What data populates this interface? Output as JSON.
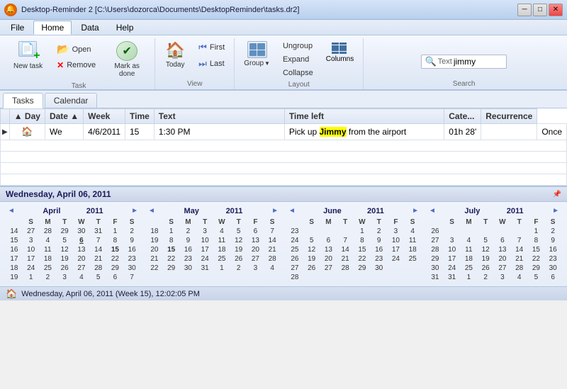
{
  "titleBar": {
    "icon": "🔔",
    "title": "Desktop-Reminder 2 [C:\\Users\\dozorca\\Documents\\DesktopReminder\\tasks.dr2]",
    "controls": {
      "minimize": "─",
      "restore": "□",
      "close": "✕"
    }
  },
  "menuBar": {
    "items": [
      "File",
      "Home",
      "Data",
      "Help"
    ],
    "activeItem": "Home"
  },
  "ribbon": {
    "groups": [
      {
        "label": "Task",
        "items": [
          {
            "id": "new-task",
            "icon": "📋",
            "label": "New task",
            "type": "large"
          },
          {
            "id": "open",
            "icon": "📂",
            "label": "Open",
            "type": "small"
          },
          {
            "id": "remove",
            "icon": "✕",
            "label": "Remove",
            "type": "small",
            "color": "red"
          },
          {
            "id": "mark-done",
            "icon": "✔",
            "label": "Mark as done",
            "type": "large-combo"
          }
        ]
      },
      {
        "label": "View",
        "items": [
          {
            "id": "today",
            "icon": "🏠",
            "label": "Today",
            "type": "large"
          },
          {
            "id": "first",
            "label": "First",
            "type": "small-nav"
          },
          {
            "id": "last",
            "label": "Last",
            "type": "small-nav"
          }
        ]
      },
      {
        "label": "Layout",
        "items": [
          {
            "id": "group",
            "icon": "▦",
            "label": "Group",
            "type": "large-arrow"
          },
          {
            "id": "ungroup",
            "label": "Ungroup",
            "type": "small"
          },
          {
            "id": "expand",
            "label": "Expand",
            "type": "small"
          },
          {
            "id": "collapse",
            "label": "Collapse",
            "type": "small"
          },
          {
            "id": "columns",
            "label": "Columns",
            "type": "columns"
          }
        ]
      },
      {
        "label": "Search",
        "items": [
          {
            "id": "search-text",
            "label": "Text",
            "placeholder": ""
          },
          {
            "id": "search-value",
            "value": "jimmy"
          }
        ]
      }
    ]
  },
  "tabs": [
    "Tasks",
    "Calendar"
  ],
  "activeTab": "Tasks",
  "taskTable": {
    "columns": [
      "",
      "Day",
      "Date",
      "Week",
      "Time",
      "Text",
      "Time left",
      "Cate...",
      "Recurrence"
    ],
    "sortCol": "Day",
    "sortDir": "asc",
    "dateSortDir": "asc",
    "rows": [
      {
        "arrow": "▶",
        "homeIcon": "🏠",
        "day": "We",
        "date": "4/6/2011",
        "week": "15",
        "time": "1:30 PM",
        "textPre": "Pick up ",
        "textHighlight": "Jimmy",
        "textPost": " from the airport",
        "timeLeft": "01h 28'",
        "category": "",
        "recurrence": "Once"
      }
    ]
  },
  "calendarSection": {
    "title": "Wednesday, April 06, 2011",
    "calendars": [
      {
        "month": "April",
        "year": "2011",
        "weekdays": [
          "S",
          "M",
          "T",
          "W",
          "T",
          "F",
          "S"
        ],
        "weeks": [
          {
            "weekNum": "14",
            "days": [
              {
                "day": "27",
                "other": true
              },
              {
                "day": "28",
                "other": true
              },
              {
                "day": "29",
                "other": true
              },
              {
                "day": "30",
                "other": true
              },
              {
                "day": "31",
                "other": true
              },
              {
                "day": "1",
                "sat": false,
                "fri": true
              },
              {
                "day": "2",
                "sat": true
              }
            ]
          },
          {
            "weekNum": "15",
            "days": [
              {
                "day": "3",
                "sun": true
              },
              {
                "day": "4"
              },
              {
                "day": "5"
              },
              {
                "day": "6",
                "today": true
              },
              {
                "day": "7"
              },
              {
                "day": "8"
              },
              {
                "day": "9",
                "sat": true
              }
            ]
          },
          {
            "weekNum": "16",
            "days": [
              {
                "day": "10",
                "sun": true
              },
              {
                "day": "11"
              },
              {
                "day": "12"
              },
              {
                "day": "13"
              },
              {
                "day": "14"
              },
              {
                "day": "15",
                "highlighted": true
              },
              {
                "day": "16",
                "sat": true
              }
            ]
          },
          {
            "weekNum": "17",
            "days": [
              {
                "day": "17",
                "sun": true
              },
              {
                "day": "18"
              },
              {
                "day": "19"
              },
              {
                "day": "20"
              },
              {
                "day": "21"
              },
              {
                "day": "22"
              },
              {
                "day": "23",
                "sat": true
              }
            ]
          },
          {
            "weekNum": "18",
            "days": [
              {
                "day": "24",
                "sun": true
              },
              {
                "day": "25"
              },
              {
                "day": "26"
              },
              {
                "day": "27"
              },
              {
                "day": "28"
              },
              {
                "day": "29"
              },
              {
                "day": "30",
                "sat": true
              }
            ]
          },
          {
            "weekNum": "19",
            "days": [
              {
                "day": "1",
                "sun": true,
                "other": true
              },
              {
                "day": "2",
                "other": true
              },
              {
                "day": "3",
                "other": true
              },
              {
                "day": "4",
                "other": true
              },
              {
                "day": "5",
                "other": true
              },
              {
                "day": "6",
                "other": true
              },
              {
                "day": "7",
                "other": true,
                "sat": true
              }
            ]
          }
        ]
      },
      {
        "month": "May",
        "year": "2011",
        "weekdays": [
          "S",
          "M",
          "T",
          "W",
          "T",
          "F",
          "S"
        ],
        "weeks": [
          {
            "weekNum": "18",
            "days": [
              {
                "day": "1",
                "sun": true
              },
              {
                "day": "2"
              },
              {
                "day": "3"
              },
              {
                "day": "4"
              },
              {
                "day": "5"
              },
              {
                "day": "6"
              },
              {
                "day": "7",
                "sat": true
              }
            ]
          },
          {
            "weekNum": "19",
            "days": [
              {
                "day": "8",
                "sun": true
              },
              {
                "day": "9"
              },
              {
                "day": "10"
              },
              {
                "day": "11"
              },
              {
                "day": "12"
              },
              {
                "day": "13"
              },
              {
                "day": "14",
                "sat": true
              }
            ]
          },
          {
            "weekNum": "20",
            "days": [
              {
                "day": "15",
                "sun": true,
                "highlighted": true
              },
              {
                "day": "16"
              },
              {
                "day": "17"
              },
              {
                "day": "18"
              },
              {
                "day": "19"
              },
              {
                "day": "20"
              },
              {
                "day": "21",
                "sat": true
              }
            ]
          },
          {
            "weekNum": "21",
            "days": [
              {
                "day": "22",
                "sun": true
              },
              {
                "day": "23"
              },
              {
                "day": "24"
              },
              {
                "day": "25"
              },
              {
                "day": "26"
              },
              {
                "day": "27"
              },
              {
                "day": "28",
                "sat": true
              }
            ]
          },
          {
            "weekNum": "22",
            "days": [
              {
                "day": "29",
                "sun": true
              },
              {
                "day": "30"
              },
              {
                "day": "31"
              },
              {
                "day": "1",
                "other": true
              },
              {
                "day": "2",
                "other": true
              },
              {
                "day": "3",
                "other": true
              },
              {
                "day": "4",
                "other": true,
                "sat": true
              }
            ]
          }
        ]
      },
      {
        "month": "June",
        "year": "2011",
        "weekdays": [
          "S",
          "M",
          "T",
          "W",
          "T",
          "F",
          "S"
        ],
        "weeks": [
          {
            "weekNum": "23",
            "days": [
              {
                "day": ""
              },
              {
                "day": ""
              },
              {
                "day": ""
              },
              {
                "day": "1"
              },
              {
                "day": "2"
              },
              {
                "day": "3"
              },
              {
                "day": "4",
                "sat": true
              }
            ]
          },
          {
            "weekNum": "24",
            "days": [
              {
                "day": "5",
                "sun": true
              },
              {
                "day": "6"
              },
              {
                "day": "7"
              },
              {
                "day": "8"
              },
              {
                "day": "9"
              },
              {
                "day": "10"
              },
              {
                "day": "11",
                "sat": true
              }
            ]
          },
          {
            "weekNum": "25",
            "days": [
              {
                "day": "12",
                "sun": true
              },
              {
                "day": "13"
              },
              {
                "day": "14"
              },
              {
                "day": "15"
              },
              {
                "day": "16"
              },
              {
                "day": "17"
              },
              {
                "day": "18",
                "sat": true
              }
            ]
          },
          {
            "weekNum": "26",
            "days": [
              {
                "day": "19",
                "sun": true
              },
              {
                "day": "20"
              },
              {
                "day": "21"
              },
              {
                "day": "22"
              },
              {
                "day": "23"
              },
              {
                "day": "24"
              },
              {
                "day": "25",
                "sat": true
              }
            ]
          },
          {
            "weekNum": "27",
            "days": [
              {
                "day": "26",
                "sun": true
              },
              {
                "day": "27"
              },
              {
                "day": "28"
              },
              {
                "day": "29"
              },
              {
                "day": "30"
              },
              {
                "day": ""
              },
              {
                "day": ""
              }
            ]
          },
          {
            "weekNum": "28",
            "days": [
              {
                "day": ""
              },
              {
                "day": ""
              },
              {
                "day": ""
              },
              {
                "day": ""
              },
              {
                "day": ""
              },
              {
                "day": ""
              },
              {
                "day": ""
              }
            ]
          }
        ]
      },
      {
        "month": "July",
        "year": "2011",
        "weekdays": [
          "S",
          "M",
          "T",
          "W",
          "T",
          "F",
          "S"
        ],
        "weeks": [
          {
            "weekNum": "26",
            "days": [
              {
                "day": ""
              },
              {
                "day": ""
              },
              {
                "day": ""
              },
              {
                "day": ""
              },
              {
                "day": ""
              },
              {
                "day": "1"
              },
              {
                "day": "2",
                "sat": true
              }
            ]
          },
          {
            "weekNum": "27",
            "days": [
              {
                "day": "3",
                "sun": true
              },
              {
                "day": "4"
              },
              {
                "day": "5"
              },
              {
                "day": "6"
              },
              {
                "day": "7"
              },
              {
                "day": "8"
              },
              {
                "day": "9",
                "sat": true
              }
            ]
          },
          {
            "weekNum": "28",
            "days": [
              {
                "day": "10",
                "sun": true
              },
              {
                "day": "11"
              },
              {
                "day": "12"
              },
              {
                "day": "13"
              },
              {
                "day": "14"
              },
              {
                "day": "15"
              },
              {
                "day": "16",
                "sat": true
              }
            ]
          },
          {
            "weekNum": "29",
            "days": [
              {
                "day": "17",
                "sun": true
              },
              {
                "day": "18"
              },
              {
                "day": "19"
              },
              {
                "day": "20"
              },
              {
                "day": "21"
              },
              {
                "day": "22"
              },
              {
                "day": "23",
                "sat": true
              }
            ]
          },
          {
            "weekNum": "30",
            "days": [
              {
                "day": "24",
                "sun": true
              },
              {
                "day": "25"
              },
              {
                "day": "26"
              },
              {
                "day": "27"
              },
              {
                "day": "28"
              },
              {
                "day": "29"
              },
              {
                "day": "30",
                "sat": true
              }
            ]
          },
          {
            "weekNum": "31",
            "days": [
              {
                "day": "31",
                "sun": true
              },
              {
                "day": "1",
                "other": true
              },
              {
                "day": "2",
                "other": true
              },
              {
                "day": "3",
                "other": true
              },
              {
                "day": "4",
                "other": true
              },
              {
                "day": "5",
                "other": true
              },
              {
                "day": "6",
                "other": true,
                "sat": true
              }
            ]
          }
        ]
      }
    ]
  },
  "statusBar": {
    "text": "Wednesday, April 06, 2011 (Week 15), 12:02:05 PM"
  }
}
